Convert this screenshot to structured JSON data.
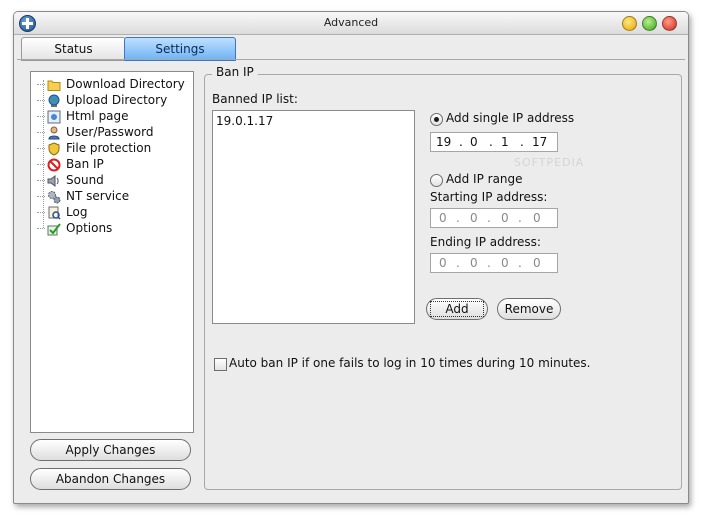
{
  "window": {
    "title": "Advanced"
  },
  "tabs": [
    {
      "label": "Status"
    },
    {
      "label": "Settings"
    }
  ],
  "tree": {
    "items": [
      {
        "label": "Download Directory",
        "icon": "folder-icon"
      },
      {
        "label": "Upload Directory",
        "icon": "globe-icon"
      },
      {
        "label": "Html page",
        "icon": "html-page-icon"
      },
      {
        "label": "User/Password",
        "icon": "user-icon"
      },
      {
        "label": "File protection",
        "icon": "shield-icon"
      },
      {
        "label": "Ban IP",
        "icon": "ban-icon"
      },
      {
        "label": "Sound",
        "icon": "speaker-icon"
      },
      {
        "label": "NT service",
        "icon": "gears-icon"
      },
      {
        "label": "Log",
        "icon": "log-icon"
      },
      {
        "label": "Options",
        "icon": "checkmark-icon"
      }
    ]
  },
  "buttons": {
    "apply": "Apply Changes",
    "abandon": "Abandon Changes",
    "add": "Add",
    "remove": "Remove"
  },
  "ban_ip": {
    "group_title": "Ban IP",
    "list_label": "Banned IP list:",
    "banned_list": [
      "19.0.1.17"
    ],
    "single_option": "Add single IP address",
    "single_ip": [
      "19",
      "0",
      "1",
      "17"
    ],
    "range_option": "Add IP range",
    "starting_label": "Starting IP address:",
    "starting_ip": [
      "0",
      "0",
      "0",
      "0"
    ],
    "ending_label": "Ending IP address:",
    "ending_ip": [
      "0",
      "0",
      "0",
      "0"
    ],
    "dot": ".",
    "auto_ban": "Auto ban IP if one fails to log in 10 times during 10 minutes."
  },
  "watermark": "SOFTPEDIA",
  "colors": {
    "selected_tab": "#6eb2f5",
    "window_bg": "#ececec"
  }
}
